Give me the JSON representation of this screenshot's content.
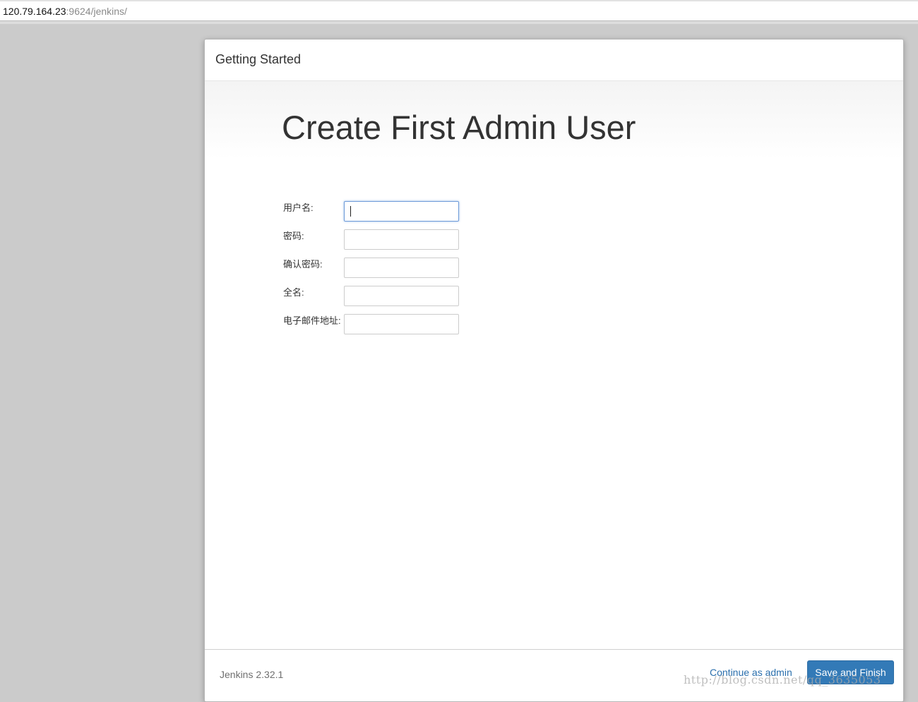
{
  "browser": {
    "url_host": "120.79.164.23",
    "url_path": ":9624/jenkins/"
  },
  "dialog": {
    "title": "Getting Started",
    "heading": "Create First Admin User",
    "fields": [
      {
        "label": "用户名:",
        "value": "",
        "focused": true
      },
      {
        "label": "密码:",
        "value": ""
      },
      {
        "label": "确认密码:",
        "value": ""
      },
      {
        "label": "全名:",
        "value": ""
      },
      {
        "label": "电子邮件地址:",
        "value": ""
      }
    ],
    "footer": {
      "version": "Jenkins 2.32.1",
      "continue_link": "Continue as admin",
      "save_button": "Save and Finish"
    }
  },
  "watermark": "http://blog.csdn.net/qq_3635053",
  "colors": {
    "primary_button": "#337ab7",
    "link": "#2a6fad",
    "page_background": "#cbcbcb"
  }
}
